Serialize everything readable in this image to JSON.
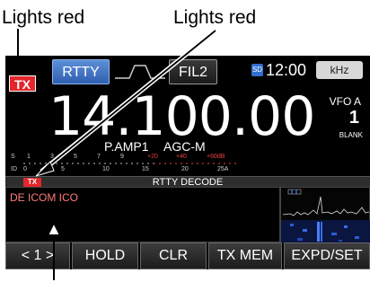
{
  "callouts": {
    "left": "Lights red",
    "center": "Lights red"
  },
  "status_bar": {
    "tx_badge": "TX",
    "mode": "RTTY",
    "filter": "FIL2",
    "sd_icon": "SD",
    "clock": "12:00",
    "unit": "kHz"
  },
  "main": {
    "frequency": "14.100.00",
    "vfo_label": "VFO A",
    "vfo_number": "1",
    "blank_label": "BLANK",
    "preamp": "P.AMP1",
    "agc": "AGC-M"
  },
  "meter": {
    "s_label": "S",
    "s_scale": [
      "1",
      "3",
      "5",
      "7",
      "9",
      "+20",
      "+40",
      "+60dB"
    ],
    "id_label": "ID",
    "id_scale": [
      "0",
      "5",
      "10",
      "15",
      "20",
      "25A"
    ]
  },
  "decode": {
    "tx_badge": "TX",
    "title": "RTTY DECODE",
    "received_text": "DE ICOM ICO"
  },
  "softkeys": [
    {
      "label": "< 1 >"
    },
    {
      "label": "HOLD"
    },
    {
      "label": "CLR"
    },
    {
      "label": "TX MEM"
    },
    {
      "label": "EXPD/SET"
    }
  ],
  "colors": {
    "tx_red": "#e3262b",
    "mode_blue": "#3a6ec0",
    "screen_bg": "#000000",
    "decode_text": "#ff7a7a"
  }
}
